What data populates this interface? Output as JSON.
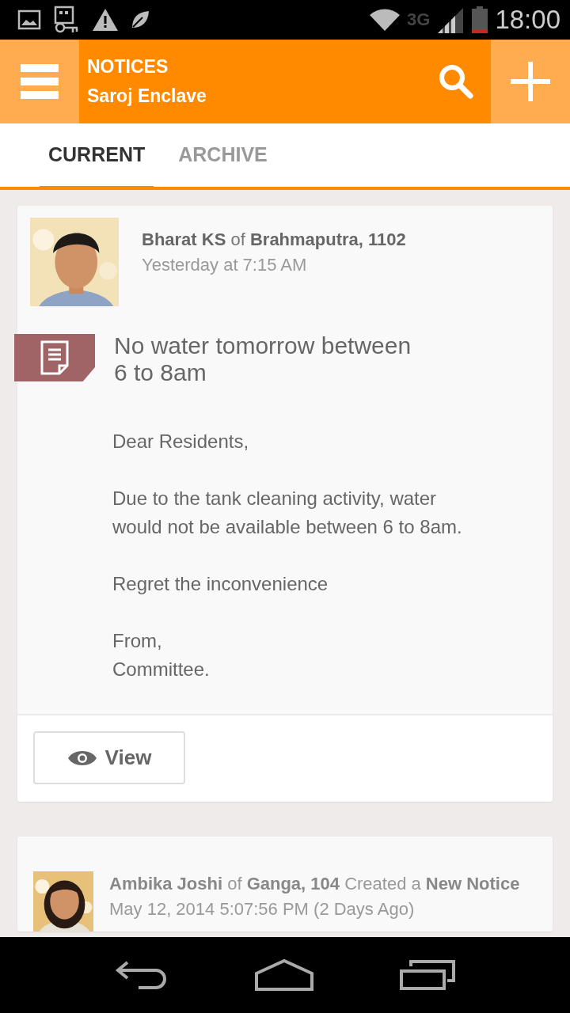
{
  "status_bar": {
    "network": "3G",
    "time": "18:00"
  },
  "app_bar": {
    "title": "NOTICES",
    "subtitle": "Saroj Enclave"
  },
  "tabs": [
    {
      "label": "CURRENT",
      "selected": true
    },
    {
      "label": "ARCHIVE",
      "selected": false
    }
  ],
  "notices": [
    {
      "author_line": "**Bharat KS** of **Brahmaputra, 1102**",
      "time": "Yesterday at 7:15 AM",
      "title": "No water tomorrow between\n6 to 8am",
      "body": [
        "Dear Residents,",
        "Due to the tank cleaning activity, water\nwould not be available between 6 to 8am.",
        "Regret the inconvenience",
        "From,\nCommittee."
      ],
      "action": "View"
    },
    {
      "author_line": "**Ambika Joshi** of **Ganga, 104** Created a **New Notice**",
      "time": "May 12, 2014 5:07:56 PM (2 Days Ago)"
    }
  ]
}
